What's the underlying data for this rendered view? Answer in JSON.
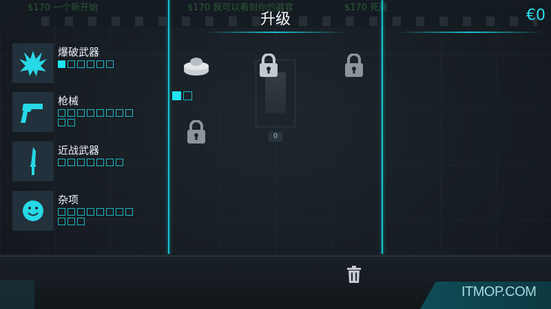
{
  "header": {
    "title": "升级",
    "money": "€0",
    "background_strip": [
      "$170 一个新开始",
      "$170 我可以看到你的器官",
      "$170 死毙"
    ]
  },
  "categories": [
    {
      "label": "爆破武器",
      "icon": "explosion-icon",
      "level": 1,
      "max": 6
    },
    {
      "label": "枪械",
      "icon": "pistol-icon",
      "level": 0,
      "max": 10
    },
    {
      "label": "近战武器",
      "icon": "knife-icon",
      "level": 0,
      "max": 7
    },
    {
      "label": "杂项",
      "icon": "smiley-icon",
      "level": 0,
      "max": 11
    }
  ],
  "upgrade_grid": {
    "mine_level": 1,
    "mine_max": 2,
    "robot_count": "0"
  },
  "watermark": "ITMOP.COM",
  "colors": {
    "accent": "#22e4f2",
    "panel": "#22313b",
    "divider": "#17c2cf"
  }
}
